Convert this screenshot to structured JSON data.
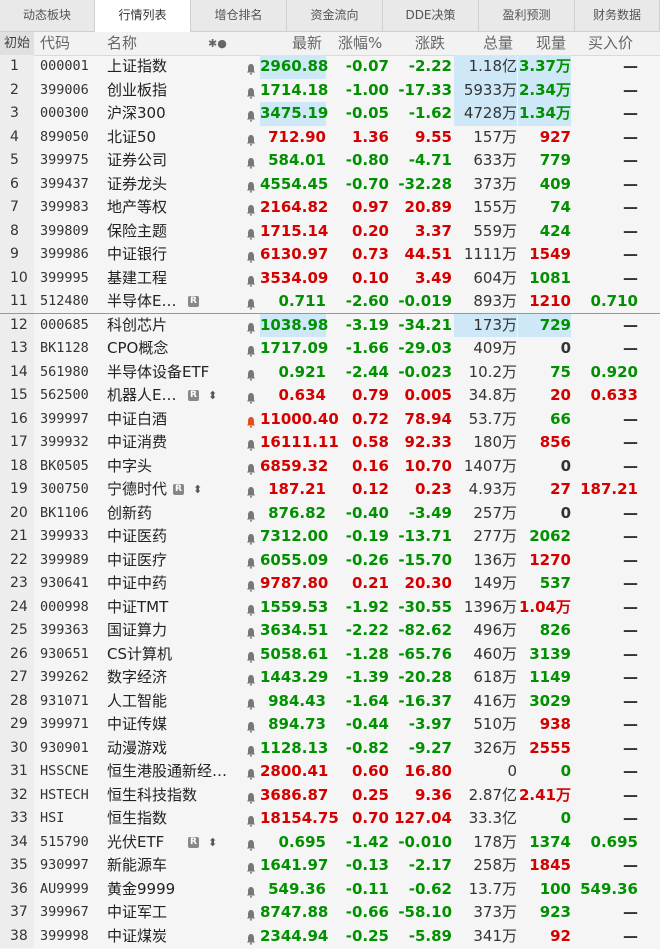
{
  "tabs": [
    "动态板块",
    "行情列表",
    "增仓排名",
    "资金流向",
    "DDE决策",
    "盈利预测",
    "财务数据"
  ],
  "active_tab": 1,
  "header": {
    "init": "初始",
    "code": "代码",
    "name": "名称",
    "marks": "✱●",
    "price": "最新",
    "pct": "涨幅%",
    "chg": "涨跌",
    "vol": "总量",
    "now": "现量",
    "bid": "买入价"
  },
  "colors": {
    "up": "#d40000",
    "down": "#009000",
    "highlight": "#cfe8f7",
    "separator": "#f08030"
  },
  "rows": [
    {
      "idx": "1",
      "code": "000001",
      "name": "上证指数",
      "bell": true,
      "price": "2960.88",
      "pct": "-0.07",
      "chg": "-2.22",
      "vol": "1.18亿",
      "now": "3.37万",
      "bid": "—",
      "dir": "down",
      "nowdir": "down",
      "hl_price": true,
      "hl_vol": true
    },
    {
      "idx": "2",
      "code": "399006",
      "name": "创业板指",
      "bell": true,
      "price": "1714.18",
      "pct": "-1.00",
      "chg": "-17.33",
      "vol": "5933万",
      "now": "2.34万",
      "bid": "—",
      "dir": "down",
      "nowdir": "down",
      "hl_price": false,
      "hl_vol": true
    },
    {
      "idx": "3",
      "code": "000300",
      "name": "沪深300",
      "bell": true,
      "price": "3475.19",
      "pct": "-0.05",
      "chg": "-1.62",
      "vol": "4728万",
      "now": "1.34万",
      "bid": "—",
      "dir": "down",
      "nowdir": "down",
      "hl_price": true,
      "hl_vol": true
    },
    {
      "idx": "4",
      "code": "899050",
      "name": "北证50",
      "bell": true,
      "price": "712.90",
      "pct": "1.36",
      "chg": "9.55",
      "vol": "157万",
      "now": "927",
      "bid": "—",
      "dir": "up",
      "nowdir": "up"
    },
    {
      "idx": "5",
      "code": "399975",
      "name": "证券公司",
      "bell": true,
      "price": "584.01",
      "pct": "-0.80",
      "chg": "-4.71",
      "vol": "633万",
      "now": "779",
      "bid": "—",
      "dir": "down",
      "nowdir": "down"
    },
    {
      "idx": "6",
      "code": "399437",
      "name": "证券龙头",
      "bell": true,
      "price": "4554.45",
      "pct": "-0.70",
      "chg": "-32.28",
      "vol": "373万",
      "now": "409",
      "bid": "—",
      "dir": "down",
      "nowdir": "down"
    },
    {
      "idx": "7",
      "code": "399983",
      "name": "地产等权",
      "bell": true,
      "price": "2164.82",
      "pct": "0.97",
      "chg": "20.89",
      "vol": "155万",
      "now": "74",
      "bid": "—",
      "dir": "up",
      "nowdir": "down"
    },
    {
      "idx": "8",
      "code": "399809",
      "name": "保险主题",
      "bell": true,
      "price": "1715.14",
      "pct": "0.20",
      "chg": "3.37",
      "vol": "559万",
      "now": "424",
      "bid": "—",
      "dir": "up",
      "nowdir": "down"
    },
    {
      "idx": "9",
      "code": "399986",
      "name": "中证银行",
      "bell": true,
      "price": "6130.97",
      "pct": "0.73",
      "chg": "44.51",
      "vol": "1111万",
      "now": "1549",
      "bid": "—",
      "dir": "up",
      "nowdir": "up"
    },
    {
      "idx": "10",
      "code": "399995",
      "name": "基建工程",
      "bell": true,
      "price": "3534.09",
      "pct": "0.10",
      "chg": "3.49",
      "vol": "604万",
      "now": "1081",
      "bid": "—",
      "dir": "up",
      "nowdir": "down"
    },
    {
      "idx": "11",
      "code": "512480",
      "name": "半导体E…",
      "flag": "R",
      "bell": true,
      "price": "0.711",
      "pct": "-2.60",
      "chg": "-0.019",
      "vol": "893万",
      "now": "1210",
      "bid": "0.710",
      "dir": "down",
      "nowdir": "up",
      "biddir": "down"
    },
    {
      "idx": "12",
      "code": "000685",
      "name": "科创芯片",
      "bell": true,
      "price": "1038.98",
      "pct": "-3.19",
      "chg": "-34.21",
      "vol": "173万",
      "now": "729",
      "bid": "—",
      "dir": "down",
      "nowdir": "down",
      "hl_price": true,
      "hl_vol": true
    },
    {
      "idx": "13",
      "code": "BK1128",
      "name": "CPO概念",
      "bell": true,
      "price": "1717.09",
      "pct": "-1.66",
      "chg": "-29.03",
      "vol": "409万",
      "now": "0",
      "bid": "—",
      "dir": "down",
      "nowdir": "black"
    },
    {
      "idx": "14",
      "code": "561980",
      "name": "半导体设备ETF",
      "bell": true,
      "price": "0.921",
      "pct": "-2.44",
      "chg": "-0.023",
      "vol": "10.2万",
      "now": "75",
      "bid": "0.920",
      "dir": "down",
      "nowdir": "down",
      "biddir": "down"
    },
    {
      "idx": "15",
      "code": "562500",
      "name": "机器人E…",
      "flag": "R",
      "updown": true,
      "bell": true,
      "price": "0.634",
      "pct": "0.79",
      "chg": "0.005",
      "vol": "34.8万",
      "now": "20",
      "bid": "0.633",
      "dir": "up",
      "nowdir": "up",
      "biddir": "up"
    },
    {
      "idx": "16",
      "code": "399997",
      "name": "中证白酒",
      "bell": true,
      "bellred": true,
      "price": "11000.40",
      "pct": "0.72",
      "chg": "78.94",
      "vol": "53.7万",
      "now": "66",
      "bid": "—",
      "dir": "up",
      "nowdir": "down"
    },
    {
      "idx": "17",
      "code": "399932",
      "name": "中证消费",
      "bell": true,
      "price": "16111.11",
      "pct": "0.58",
      "chg": "92.33",
      "vol": "180万",
      "now": "856",
      "bid": "—",
      "dir": "up",
      "nowdir": "up"
    },
    {
      "idx": "18",
      "code": "BK0505",
      "name": "中字头",
      "bell": true,
      "price": "6859.32",
      "pct": "0.16",
      "chg": "10.70",
      "vol": "1407万",
      "now": "0",
      "bid": "—",
      "dir": "up",
      "nowdir": "black"
    },
    {
      "idx": "19",
      "code": "300750",
      "name": "宁德时代",
      "flag": "R",
      "updown": true,
      "bell": true,
      "price": "187.21",
      "pct": "0.12",
      "chg": "0.23",
      "vol": "4.93万",
      "now": "27",
      "bid": "187.21",
      "dir": "up",
      "nowdir": "up",
      "biddir": "up"
    },
    {
      "idx": "20",
      "code": "BK1106",
      "name": "创新药",
      "bell": true,
      "price": "876.82",
      "pct": "-0.40",
      "chg": "-3.49",
      "vol": "257万",
      "now": "0",
      "bid": "—",
      "dir": "down",
      "nowdir": "black"
    },
    {
      "idx": "21",
      "code": "399933",
      "name": "中证医药",
      "bell": true,
      "price": "7312.00",
      "pct": "-0.19",
      "chg": "-13.71",
      "vol": "277万",
      "now": "2062",
      "bid": "—",
      "dir": "down",
      "nowdir": "down"
    },
    {
      "idx": "22",
      "code": "399989",
      "name": "中证医疗",
      "bell": true,
      "price": "6055.09",
      "pct": "-0.26",
      "chg": "-15.70",
      "vol": "136万",
      "now": "1270",
      "bid": "—",
      "dir": "down",
      "nowdir": "up"
    },
    {
      "idx": "23",
      "code": "930641",
      "name": "中证中药",
      "bell": true,
      "price": "9787.80",
      "pct": "0.21",
      "chg": "20.30",
      "vol": "149万",
      "now": "537",
      "bid": "—",
      "dir": "up",
      "nowdir": "down"
    },
    {
      "idx": "24",
      "code": "000998",
      "name": "中证TMT",
      "bell": true,
      "price": "1559.53",
      "pct": "-1.92",
      "chg": "-30.55",
      "vol": "1396万",
      "now": "1.04万",
      "bid": "—",
      "dir": "down",
      "nowdir": "up"
    },
    {
      "idx": "25",
      "code": "399363",
      "name": "国证算力",
      "bell": true,
      "price": "3634.51",
      "pct": "-2.22",
      "chg": "-82.62",
      "vol": "496万",
      "now": "826",
      "bid": "—",
      "dir": "down",
      "nowdir": "down"
    },
    {
      "idx": "26",
      "code": "930651",
      "name": "CS计算机",
      "bell": true,
      "price": "5058.61",
      "pct": "-1.28",
      "chg": "-65.76",
      "vol": "460万",
      "now": "3139",
      "bid": "—",
      "dir": "down",
      "nowdir": "down"
    },
    {
      "idx": "27",
      "code": "399262",
      "name": "数字经济",
      "bell": true,
      "price": "1443.29",
      "pct": "-1.39",
      "chg": "-20.28",
      "vol": "618万",
      "now": "1149",
      "bid": "—",
      "dir": "down",
      "nowdir": "down"
    },
    {
      "idx": "28",
      "code": "931071",
      "name": "人工智能",
      "bell": true,
      "price": "984.43",
      "pct": "-1.64",
      "chg": "-16.37",
      "vol": "416万",
      "now": "3029",
      "bid": "—",
      "dir": "down",
      "nowdir": "down"
    },
    {
      "idx": "29",
      "code": "399971",
      "name": "中证传媒",
      "bell": true,
      "price": "894.73",
      "pct": "-0.44",
      "chg": "-3.97",
      "vol": "510万",
      "now": "938",
      "bid": "—",
      "dir": "down",
      "nowdir": "up"
    },
    {
      "idx": "30",
      "code": "930901",
      "name": "动漫游戏",
      "bell": true,
      "price": "1128.13",
      "pct": "-0.82",
      "chg": "-9.27",
      "vol": "326万",
      "now": "2555",
      "bid": "—",
      "dir": "down",
      "nowdir": "up"
    },
    {
      "idx": "31",
      "code": "HSSCNE",
      "name": "恒生港股通新经…",
      "bell": true,
      "price": "2800.41",
      "pct": "0.60",
      "chg": "16.80",
      "vol": "0",
      "now": "0",
      "bid": "—",
      "dir": "up",
      "nowdir": "down"
    },
    {
      "idx": "32",
      "code": "HSTECH",
      "name": "恒生科技指数",
      "bell": true,
      "price": "3686.87",
      "pct": "0.25",
      "chg": "9.36",
      "vol": "2.87亿",
      "now": "2.41万",
      "bid": "—",
      "dir": "up",
      "nowdir": "up"
    },
    {
      "idx": "33",
      "code": "HSI",
      "name": "恒生指数",
      "bell": true,
      "price": "18154.75",
      "pct": "0.70",
      "chg": "127.04",
      "vol": "33.3亿",
      "now": "0",
      "bid": "—",
      "dir": "up",
      "nowdir": "down"
    },
    {
      "idx": "34",
      "code": "515790",
      "name": "光伏ETF",
      "flag": "R",
      "updown": true,
      "bell": true,
      "price": "0.695",
      "pct": "-1.42",
      "chg": "-0.010",
      "vol": "178万",
      "now": "1374",
      "bid": "0.695",
      "dir": "down",
      "nowdir": "down",
      "biddir": "down"
    },
    {
      "idx": "35",
      "code": "930997",
      "name": "新能源车",
      "bell": true,
      "price": "1641.97",
      "pct": "-0.13",
      "chg": "-2.17",
      "vol": "258万",
      "now": "1845",
      "bid": "—",
      "dir": "down",
      "nowdir": "up"
    },
    {
      "idx": "36",
      "code": "AU9999",
      "name": "黄金9999",
      "bell": true,
      "price": "549.36",
      "pct": "-0.11",
      "chg": "-0.62",
      "vol": "13.7万",
      "now": "100",
      "bid": "549.36",
      "dir": "down",
      "nowdir": "down",
      "biddir": "down"
    },
    {
      "idx": "37",
      "code": "399967",
      "name": "中证军工",
      "bell": true,
      "price": "8747.88",
      "pct": "-0.66",
      "chg": "-58.10",
      "vol": "373万",
      "now": "923",
      "bid": "—",
      "dir": "down",
      "nowdir": "down"
    },
    {
      "idx": "38",
      "code": "399998",
      "name": "中证煤炭",
      "bell": true,
      "price": "2344.94",
      "pct": "-0.25",
      "chg": "-5.89",
      "vol": "341万",
      "now": "92",
      "bid": "—",
      "dir": "down",
      "nowdir": "up"
    }
  ]
}
